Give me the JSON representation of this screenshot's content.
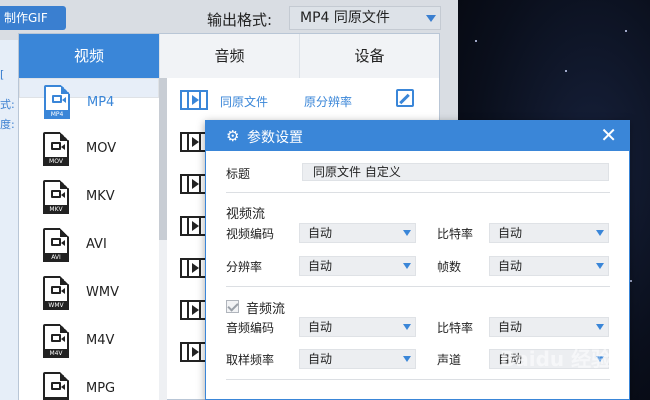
{
  "gif_button": "制作GIF",
  "left_strip": [
    "[",
    "式:",
    "度:"
  ],
  "output_format": {
    "label": "输出格式:",
    "value": "MP4  同原文件"
  },
  "tabs": [
    "视频",
    "音频",
    "设备"
  ],
  "formats": [
    {
      "name": "MP4",
      "tag": "MP4",
      "selected": true
    },
    {
      "name": "MOV",
      "tag": "MOV",
      "selected": false
    },
    {
      "name": "MKV",
      "tag": "MKV",
      "selected": false
    },
    {
      "name": "AVI",
      "tag": "AVI",
      "selected": false
    },
    {
      "name": "WMV",
      "tag": "WMV",
      "selected": false
    },
    {
      "name": "M4V",
      "tag": "M4V",
      "selected": false
    },
    {
      "name": "MPG",
      "tag": "",
      "selected": false
    }
  ],
  "presets": [
    {
      "label": "同原文件",
      "resolution": "原分辨率"
    }
  ],
  "dialog": {
    "title": "参数设置",
    "close": "✕",
    "title_label": "标题",
    "title_value": "同原文件 自定义",
    "video_section": "视频流",
    "video_codec_label": "视频编码",
    "video_codec": "自动",
    "bitrate_label": "比特率",
    "bitrate": "自动",
    "resolution_label": "分辨率",
    "resolution": "自动",
    "framerate_label": "帧数",
    "framerate": "自动",
    "audio_section": "音频流",
    "audio_codec_label": "音频编码",
    "audio_codec": "自动",
    "audio_bitrate_label": "比特率",
    "audio_bitrate": "自动",
    "samplerate_label": "取样频率",
    "samplerate": "自动",
    "channel_label": "声道",
    "channel": "自动"
  },
  "watermark": "Baidu 经验",
  "colors": {
    "accent": "#3a86d8"
  }
}
